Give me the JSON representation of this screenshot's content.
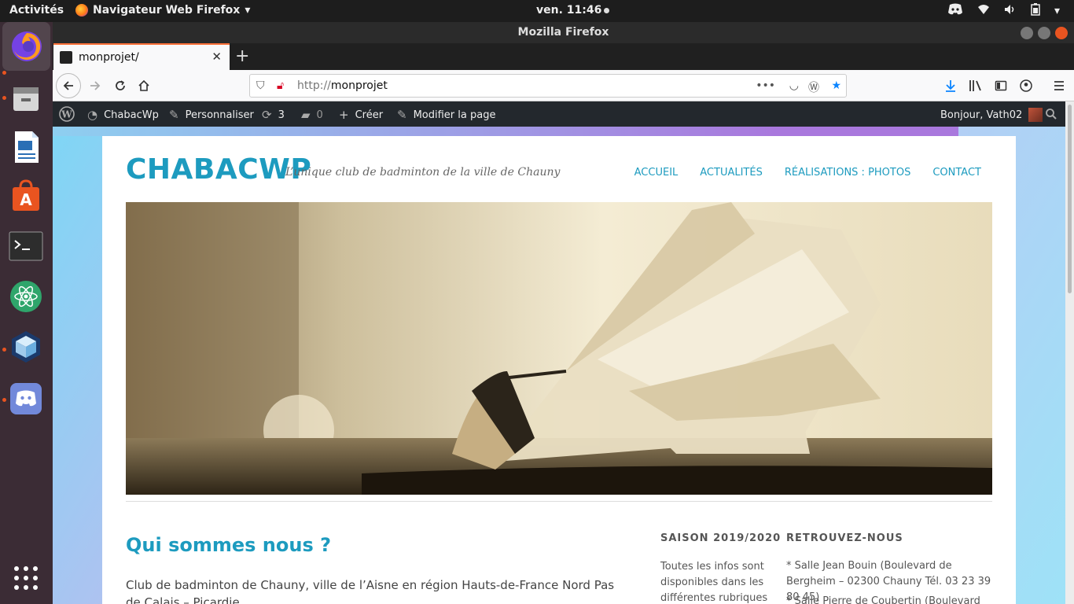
{
  "topbar": {
    "activities": "Activités",
    "app_menu": "Navigateur Web Firefox",
    "clock": "ven. 11:46"
  },
  "window": {
    "title": "Mozilla Firefox",
    "tab_title": "monprojet/",
    "url_protocol": "http://",
    "url_host": "monprojet"
  },
  "adminbar": {
    "site": "ChabacWp",
    "customize": "Personnaliser",
    "updates": "3",
    "comments": "0",
    "create": "Créer",
    "edit": "Modifier la page",
    "greeting": "Bonjour, Vath02"
  },
  "site": {
    "title": "CHABACWP",
    "tagline": "L’unique club de badminton de la ville de Chauny",
    "menu": [
      "ACCUEIL",
      "ACTUALITÉS",
      "RÉALISATIONS : PHOTOS",
      "CONTACT"
    ],
    "heading": "Qui sommes nous ?",
    "intro": "Club de badminton de Chauny, ville de l’Aisne en région Hauts-de-France Nord Pas de Calais – Picardie.",
    "widget1_title": "SAISON 2019/2020",
    "widget1_text": "Toutes les infos sont disponibles dans les différentes rubriques",
    "widget2_title": "RETROUVEZ-NOUS",
    "widget2_line1": "* Salle Jean Bouin (Boulevard de Bergheim – 02300 Chauny  Tél. 03 23 39 80 45)",
    "widget2_line2": "* Salle Pierre de Coubertin (Boulevard de"
  },
  "colors": {
    "accent": "#1d9bbf",
    "ubuntu_orange": "#e95420"
  }
}
